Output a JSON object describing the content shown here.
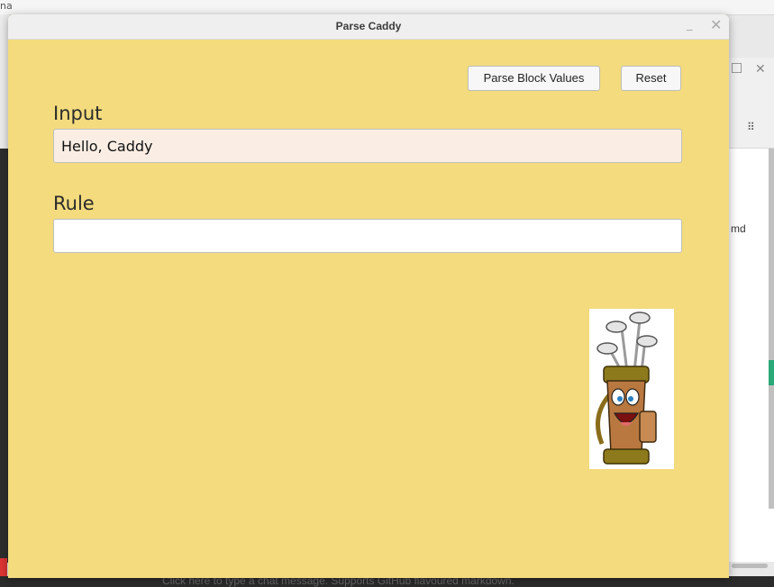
{
  "background": {
    "top_text": "na",
    "right_panel_text": "md",
    "bottom_text": "Click here to type a chat message. Supports GitHub flavoured markdown."
  },
  "window": {
    "title": "Parse Caddy",
    "minimize_glyph": "_",
    "close_glyph": "✕",
    "background_color": "#f3db7e"
  },
  "toolbar": {
    "parse_label": "Parse Block Values",
    "reset_label": "Reset"
  },
  "form": {
    "input_label": "Input",
    "input_value": "Hello, Caddy",
    "rule_label": "Rule",
    "rule_value": ""
  },
  "mascot": {
    "icon": "golf-bag-mascot-icon"
  }
}
